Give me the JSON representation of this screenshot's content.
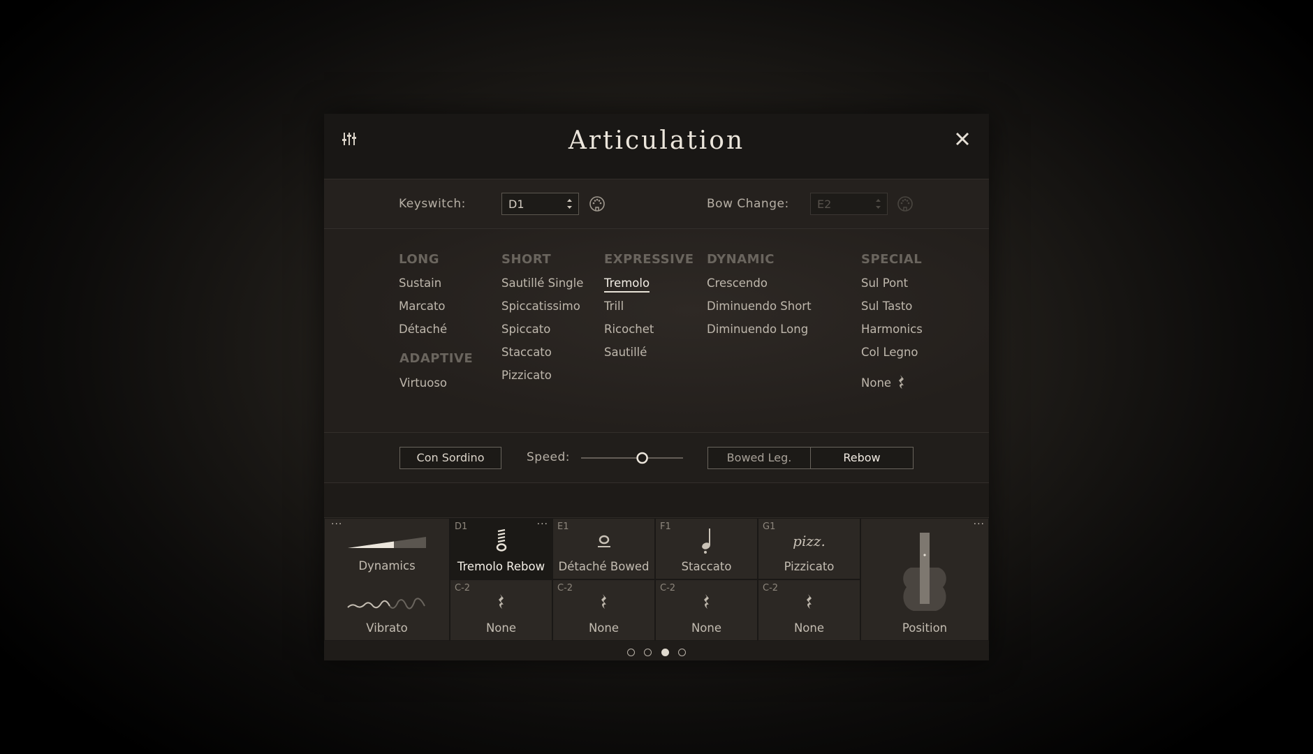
{
  "header": {
    "title": "Articulation"
  },
  "keyswitch": {
    "label": "Keyswitch:",
    "value": "D1"
  },
  "bow_change": {
    "label": "Bow Change:",
    "value": "E2"
  },
  "categories": {
    "long": {
      "title": "LONG",
      "items": [
        "Sustain",
        "Marcato",
        "Détaché"
      ]
    },
    "short": {
      "title": "SHORT",
      "items": [
        "Sautillé Single",
        "Spiccatissimo",
        "Spiccato",
        "Staccato",
        "Pizzicato"
      ]
    },
    "expressive": {
      "title": "EXPRESSIVE",
      "items": [
        "Tremolo",
        "Trill",
        "Ricochet",
        "Sautillé"
      ],
      "selected": "Tremolo"
    },
    "dynamic": {
      "title": "DYNAMIC",
      "items": [
        "Crescendo",
        "Diminuendo Short",
        "Diminuendo Long"
      ]
    },
    "special": {
      "title": "SPECIAL",
      "items": [
        "Sul Pont",
        "Sul Tasto",
        "Harmonics",
        "Col Legno"
      ],
      "none_label": "None"
    },
    "adaptive": {
      "title": "ADAPTIVE",
      "items": [
        "Virtuoso"
      ]
    }
  },
  "controls": {
    "con_sordino": "Con Sordino",
    "speed_label": "Speed:",
    "speed_value": 0.6,
    "bowed_leg": "Bowed Leg.",
    "rebow": "Rebow",
    "rebow_selected": true
  },
  "tiles": {
    "dynamics": "Dynamics",
    "vibrato": "Vibrato",
    "position": "Position",
    "top": [
      {
        "key": "D1",
        "name": "Tremolo Rebow",
        "active": true
      },
      {
        "key": "E1",
        "name": "Détaché Bowed"
      },
      {
        "key": "F1",
        "name": "Staccato"
      },
      {
        "key": "G1",
        "name": "Pizzicato",
        "glyph": "pizz."
      }
    ],
    "bottom": [
      {
        "key": "C-2",
        "name": "None"
      },
      {
        "key": "C-2",
        "name": "None"
      },
      {
        "key": "C-2",
        "name": "None"
      },
      {
        "key": "C-2",
        "name": "None"
      }
    ],
    "more": "···"
  },
  "pager": {
    "pages": 4,
    "current": 3
  },
  "colors": {
    "accent": "#ece6dc",
    "category": "#6a655e",
    "panel": "#1f1c19"
  }
}
